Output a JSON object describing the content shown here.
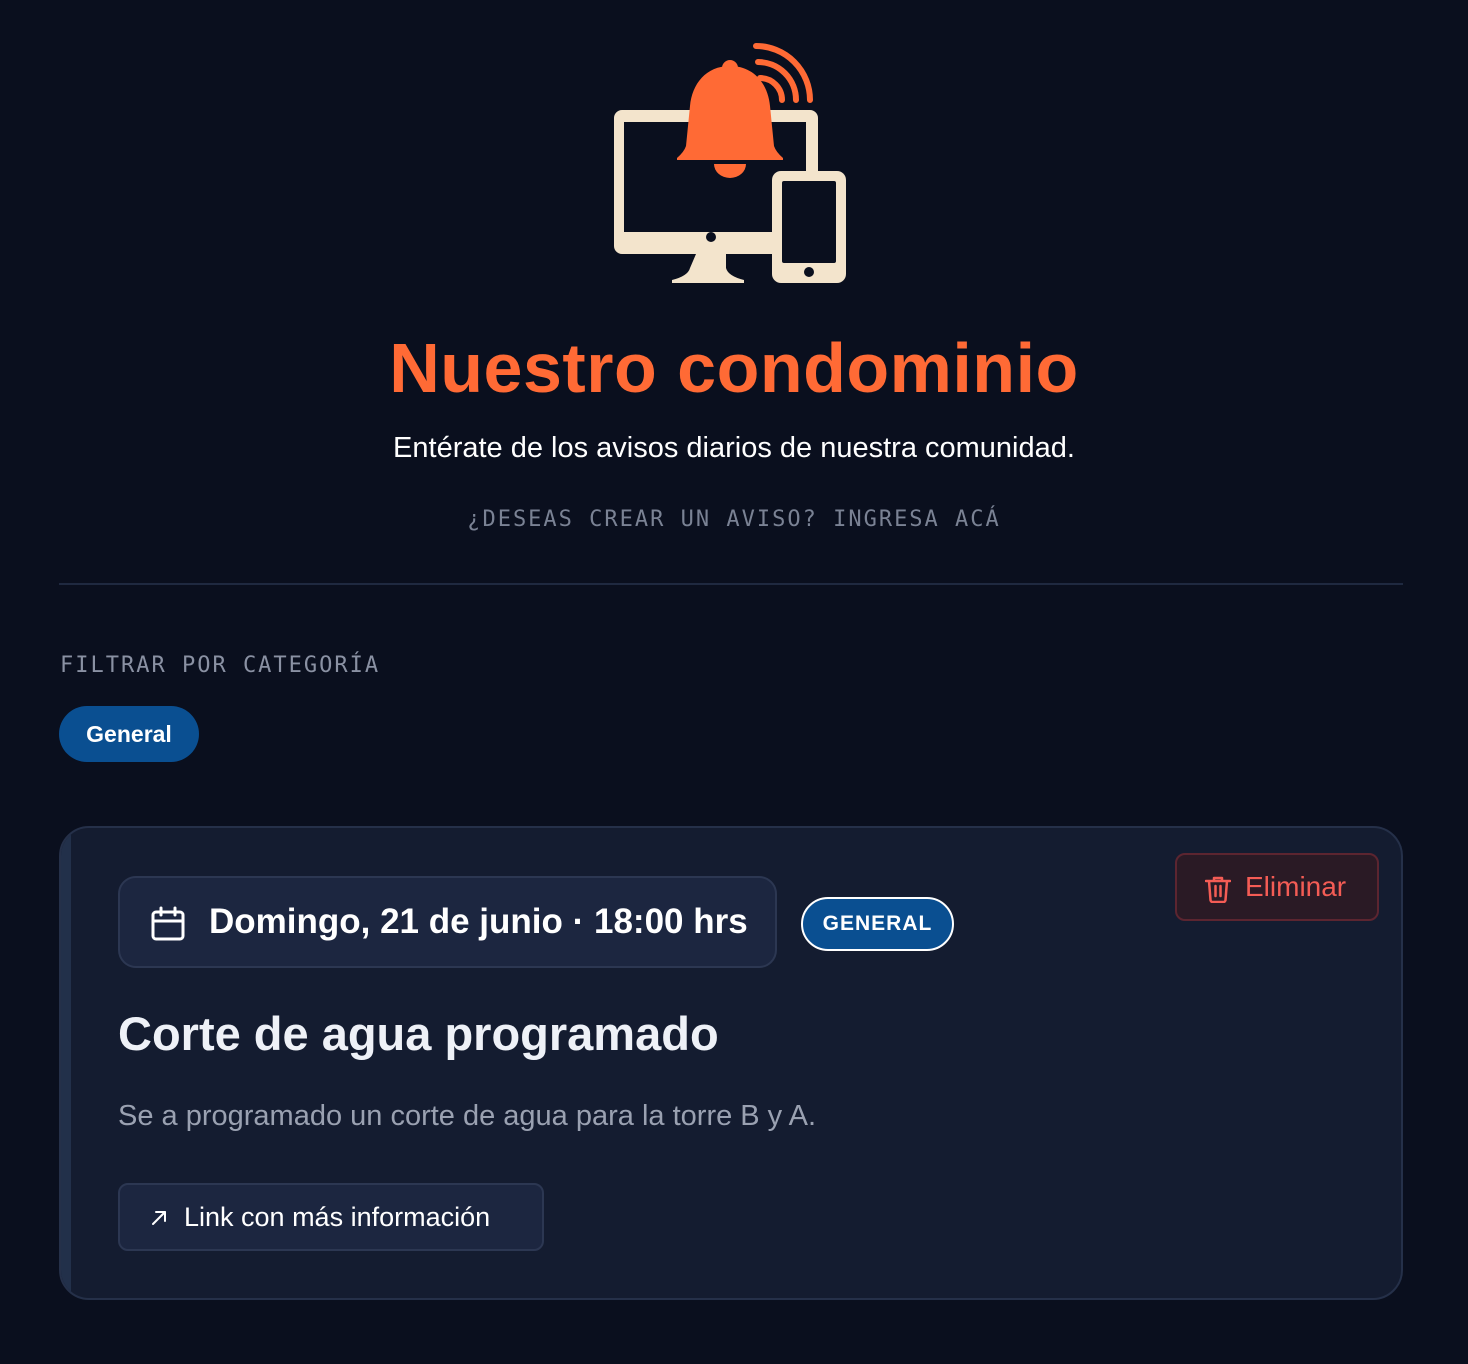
{
  "header": {
    "icon": "notification-devices-icon",
    "title": "Nuestro condominio",
    "subtitle": "Entérate de los avisos diarios de nuestra comunidad.",
    "create_link": "¿DESEAS CREAR UN AVISO? INGRESA ACÁ"
  },
  "filter": {
    "label": "FILTRAR POR CATEGORÍA",
    "chips": [
      {
        "label": "General",
        "selected": true
      }
    ]
  },
  "notices": [
    {
      "date_icon": "calendar-icon",
      "date": "Domingo, 21 de junio · 18:00 hrs",
      "category": "GENERAL",
      "delete_icon": "trash-icon",
      "delete_label": "Eliminar",
      "title": "Corte de agua programado",
      "body": "Se a programado un corte de agua para la torre B y A.",
      "link_icon": "arrow-up-right-icon",
      "link_label": "Link con más información"
    }
  ],
  "colors": {
    "background": "#0a0f1e",
    "accent": "#ff6a35",
    "cream": "#f3e4cc",
    "chip_blue": "#0a4f91",
    "card": "#141c30",
    "danger": "#f45c55"
  }
}
